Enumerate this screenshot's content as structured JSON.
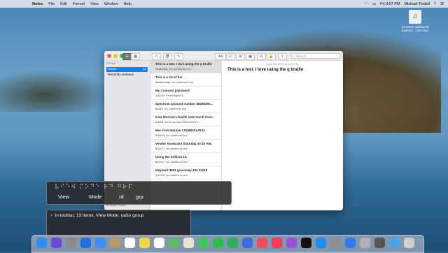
{
  "menubar": {
    "apple": "",
    "app": "Notes",
    "items": [
      "File",
      "Edit",
      "Format",
      "View",
      "Window",
      "Help"
    ],
    "clock": "Fri 3:07 PM",
    "user": "Michael Tindell"
  },
  "desktop_file": {
    "label": "14 Some additional keyboar...cuts.mp4"
  },
  "window": {
    "search_placeholder": "Search",
    "sidebar": {
      "account": "iCloud",
      "folders": [
        {
          "label": "Notes",
          "count": "12"
        },
        {
          "label": "Recently Deleted",
          "count": ""
        }
      ],
      "new_folder": "New Folder"
    },
    "notes": [
      {
        "title": "This is a test. I love using the q braille",
        "date": "Yesterday",
        "preview": "No additional text"
      },
      {
        "title": "This is a lot of fun",
        "date": "Wednesday",
        "preview": "No additional text"
      },
      {
        "title": "My Comcast password",
        "date": "1/11/20",
        "preview": "Phoebagbe11"
      },
      {
        "title": "Spectrum account number 49288450...",
        "date": "6/5/19",
        "preview": "No additional text"
      },
      {
        "title": "Kate Morrow's braille note touch from...",
        "date": "6/4/18",
        "preview": "serial number 6504000015"
      },
      {
        "title": "Mac from Harlow C02M83XLF8J3",
        "date": "3/18/18",
        "preview": "No additional text"
      },
      {
        "title": "Vendor showcase Saturday 10:10 AM.",
        "date": "6/26/17",
        "preview": "No additional text"
      },
      {
        "title": "Using the brilliant 14.",
        "date": "6/27/17",
        "preview": "No additional text"
      },
      {
        "title": "Maynard 3601 greenway 402 21218",
        "date": "3/12/15",
        "preview": "No additional text"
      }
    ],
    "editor": {
      "date": "April 23, 2020 at 1:50 PM",
      "body": "This is a test. I love using the q braille"
    }
  },
  "braille": {
    "dots": "⠧⠊⠑⠺ ⠍⠕⠙⠑ ⠗⠙ ⠛⠗⠏",
    "words": [
      "View",
      "Mode",
      "rd",
      "grp"
    ]
  },
  "caption": {
    "close": "×",
    "text": "In toolbar, 13 items, View Mode, radio group"
  },
  "dock": {
    "icons": [
      "finder-icon",
      "siri-icon",
      "launchpad-icon",
      "safari-icon",
      "mail-icon",
      "contacts-icon",
      "calendar-icon",
      "notes-icon",
      "reminders-icon",
      "maps-icon",
      "photos-icon",
      "messages-icon",
      "facetime-icon",
      "numbers-icon",
      "keynote-icon",
      "news-icon",
      "music-icon",
      "podcasts-icon",
      "tv-icon",
      "appstore-icon",
      "settings-icon",
      "zoom-icon",
      "utility-icon",
      "voiceover-icon",
      "folder-icon",
      "trash-icon"
    ],
    "colors": [
      "#2f8cf0",
      "#6b4ad6",
      "#8a8a8a",
      "#1f6fe0",
      "#3a8ef5",
      "#b89a6a",
      "#ffffff",
      "#f5d44a",
      "#ffffff",
      "#5dbb63",
      "#e9e0d8",
      "#3cc85c",
      "#2dbe4e",
      "#2fae5a",
      "#3b6ee0",
      "#f24d5a",
      "#fa3c58",
      "#9c4fd9",
      "#111111",
      "#1e8cf5",
      "#8f8f8f",
      "#2d7cf6",
      "#b0b0b0",
      "#555555",
      "#4aa3e8",
      "#cfcfcf"
    ]
  }
}
